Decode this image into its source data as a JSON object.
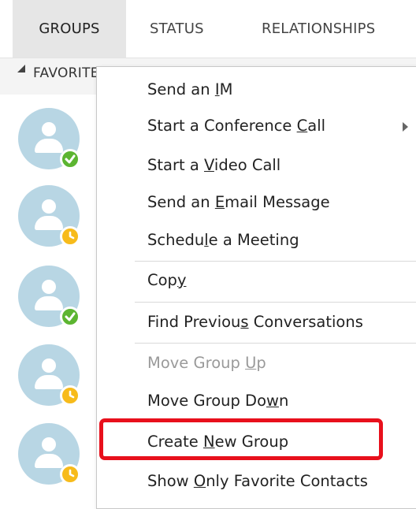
{
  "tabs": [
    {
      "label": "GROUPS",
      "active": true
    },
    {
      "label": "STATUS",
      "active": false
    },
    {
      "label": "RELATIONSHIPS",
      "active": false
    }
  ],
  "group": {
    "label": "FAVORITES"
  },
  "contacts": [
    {
      "presence": "available",
      "icon": "check-icon"
    },
    {
      "presence": "away",
      "icon": "clock-icon"
    },
    {
      "presence": "available",
      "icon": "check-icon"
    },
    {
      "presence": "away",
      "icon": "clock-icon"
    },
    {
      "presence": "away",
      "icon": "clock-icon"
    }
  ],
  "menu": {
    "items": [
      {
        "pre": "Send an ",
        "key": "I",
        "post": "M",
        "disabled": false
      },
      {
        "pre": "Start a Conference ",
        "key": "C",
        "post": "all",
        "disabled": false,
        "submenu": true
      },
      {
        "pre": "Start a ",
        "key": "V",
        "post": "ideo Call",
        "disabled": false
      },
      {
        "pre": "Send an ",
        "key": "E",
        "post": "mail Message",
        "disabled": false
      },
      {
        "pre": "Schedu",
        "key": "l",
        "post": "e a Meeting",
        "disabled": false
      },
      {
        "pre": "Cop",
        "key": "y",
        "post": "",
        "disabled": false
      },
      {
        "pre": "Find Previou",
        "key": "s",
        "post": " Conversations",
        "disabled": false
      },
      {
        "pre": "Move Group ",
        "key": "U",
        "post": "p",
        "disabled": true
      },
      {
        "pre": "Move Group Do",
        "key": "w",
        "post": "n",
        "disabled": false
      },
      {
        "pre": "Create ",
        "key": "N",
        "post": "ew Group",
        "disabled": false
      },
      {
        "pre": "Show ",
        "key": "O",
        "post": "nly Favorite Contacts",
        "disabled": false
      }
    ]
  },
  "colors": {
    "highlight": "#e8101c",
    "available": "#5cb531",
    "away": "#f7bb1b",
    "avatar": "#b8d6e4"
  }
}
